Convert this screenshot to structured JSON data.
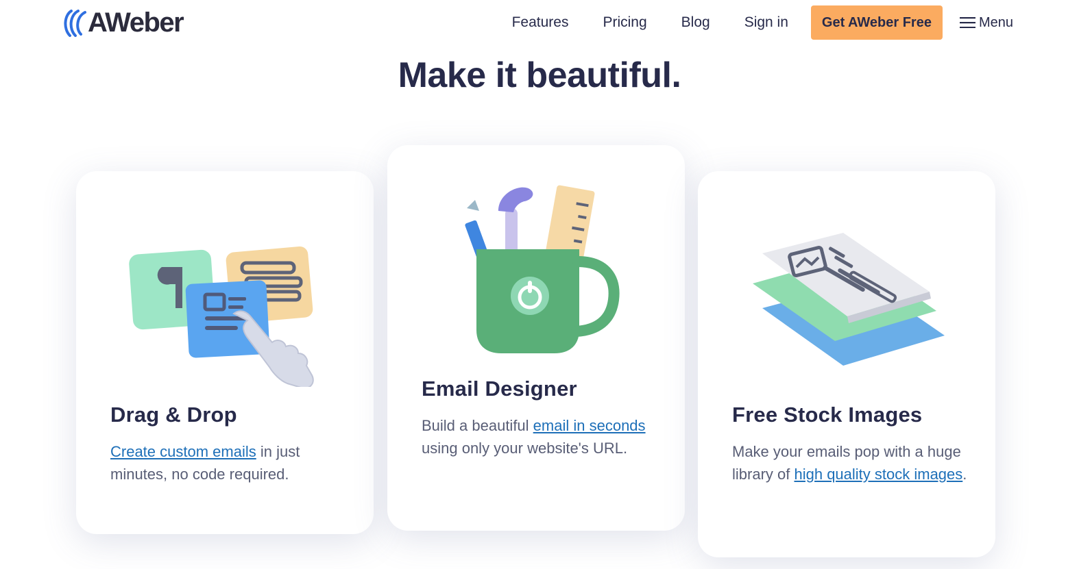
{
  "header": {
    "logo_text": "AWeber",
    "nav": {
      "features": "Features",
      "pricing": "Pricing",
      "blog": "Blog",
      "signin": "Sign in",
      "cta": "Get AWeber Free",
      "menu": "Menu"
    }
  },
  "headline": "Make it beautiful.",
  "cards": [
    {
      "title": "Drag & Drop",
      "link": "Create custom emails",
      "text_after": " in just minutes, no code required.",
      "icon": "drag-drop-illustration"
    },
    {
      "title": "Email Designer",
      "text_before": "Build a beautiful ",
      "link": "email in seconds",
      "text_after": " using only your website's URL.",
      "icon": "mug-illustration"
    },
    {
      "title": "Free Stock Images",
      "text_before": "Make your emails pop with a huge library of ",
      "link": "high quality stock images",
      "text_after": ".",
      "icon": "stock-images-illustration"
    }
  ],
  "colors": {
    "cta": "#fbab60",
    "link": "#1d6fb8",
    "heading": "#272a4a",
    "logo_blue": "#2f6fe0"
  }
}
